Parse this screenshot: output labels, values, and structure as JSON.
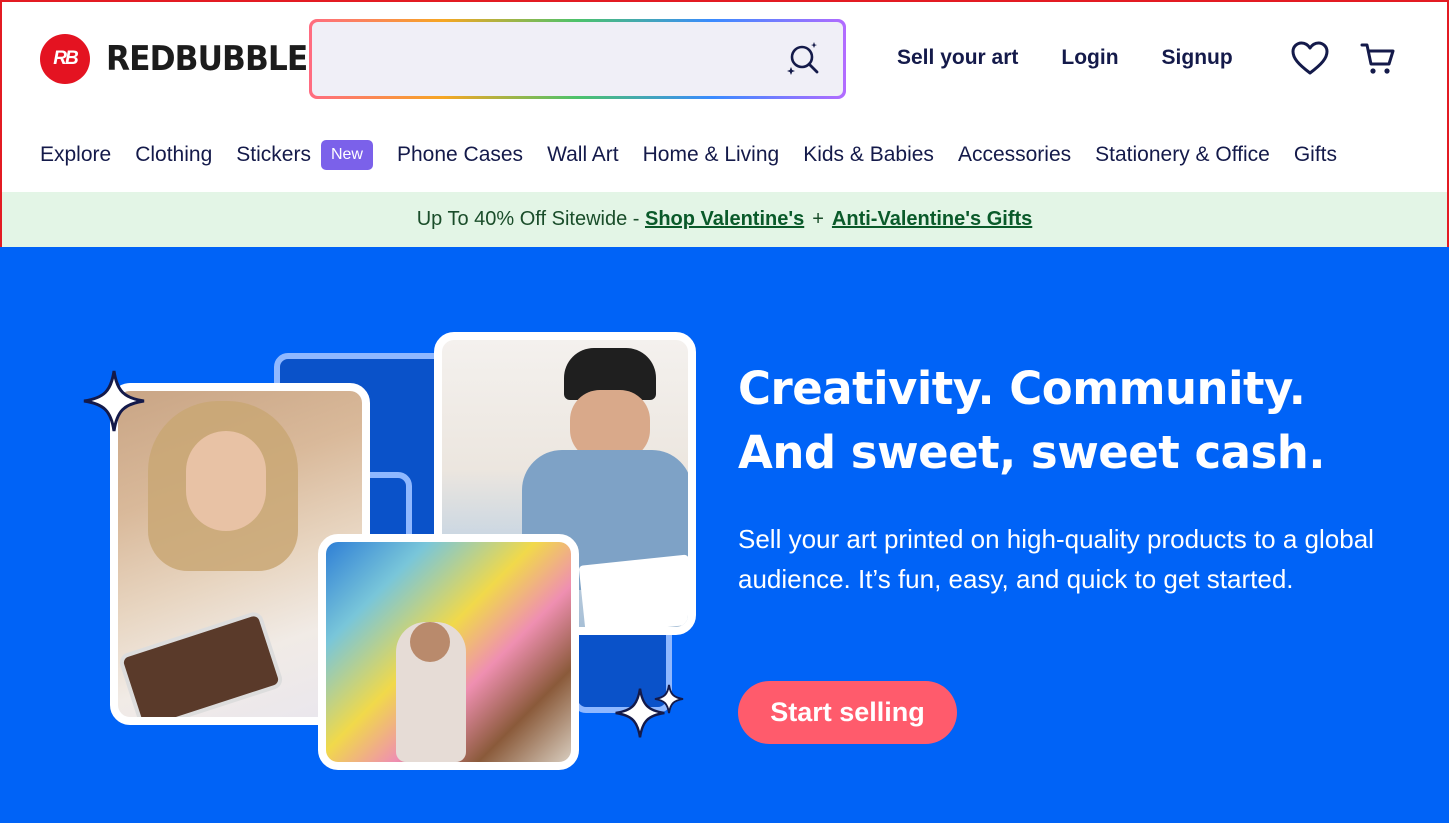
{
  "brand": {
    "name": "REDBUBBLE",
    "mark": "RB",
    "color": "#e41321"
  },
  "search": {
    "placeholder": "",
    "value": "",
    "icon": "sparkle-search-icon"
  },
  "top_nav": [
    {
      "label": "Sell your art"
    },
    {
      "label": "Login"
    },
    {
      "label": "Signup"
    }
  ],
  "icons": {
    "wishlist": "heart-icon",
    "cart": "cart-icon"
  },
  "categories": [
    {
      "label": "Explore"
    },
    {
      "label": "Clothing"
    },
    {
      "label": "Stickers",
      "badge": "New"
    },
    {
      "label": "Phone Cases"
    },
    {
      "label": "Wall Art"
    },
    {
      "label": "Home & Living"
    },
    {
      "label": "Kids & Babies"
    },
    {
      "label": "Accessories"
    },
    {
      "label": "Stationery & Office"
    },
    {
      "label": "Gifts"
    }
  ],
  "promo": {
    "text": "Up To 40% Off Sitewide - ",
    "link1": "Shop Valentine's",
    "sep": "+",
    "link2": "Anti-Valentine's Gifts"
  },
  "hero": {
    "headline_line1": "Creativity. Community.",
    "headline_line2": "And sweet, sweet cash.",
    "subtext": "Sell your art printed on high-quality products to a global audience. It’s fun, easy, and quick to get started.",
    "cta": "Start selling",
    "background": "#0063f7",
    "cta_color": "#ff5b6c"
  }
}
